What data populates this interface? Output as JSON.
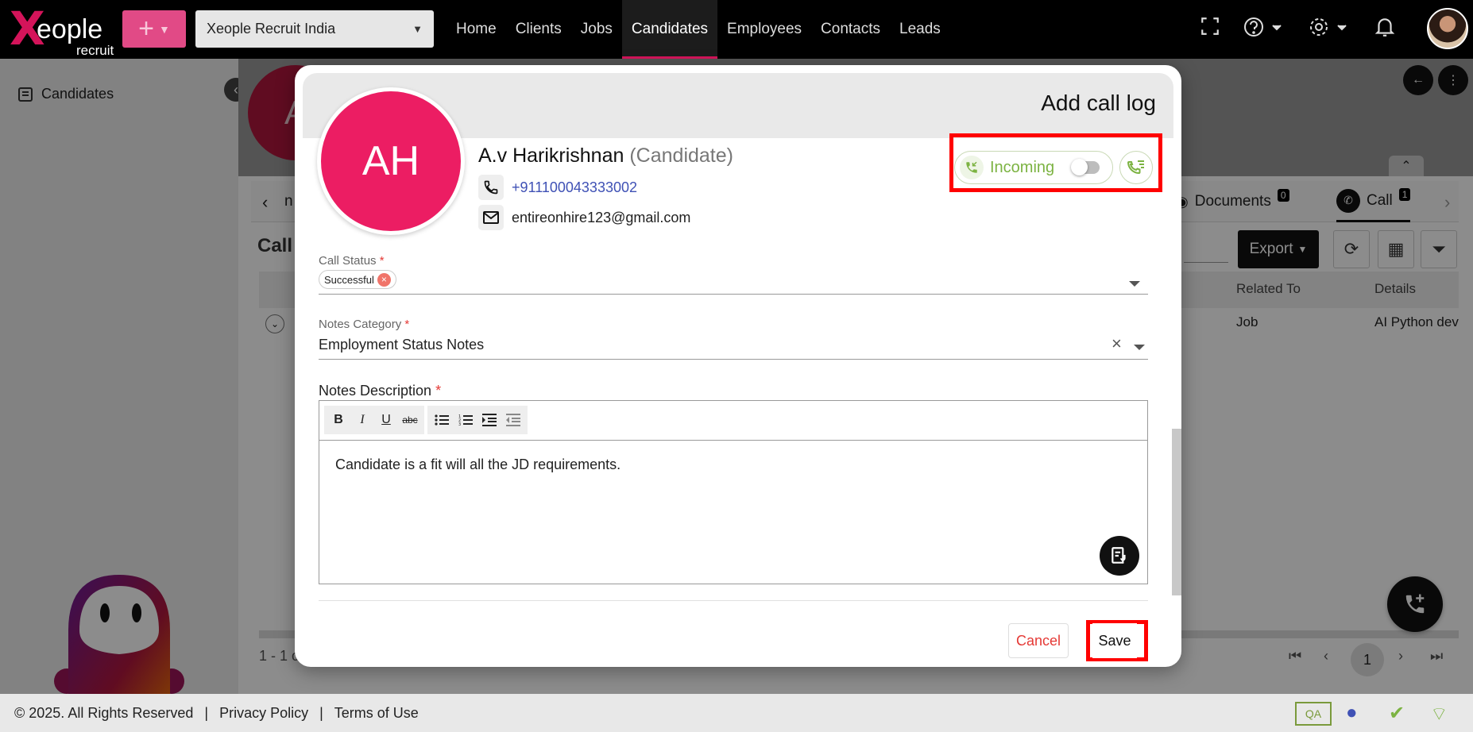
{
  "brand": {
    "logo_x": "X",
    "logo_word": "eople",
    "logo_sub": "recruit",
    "accent": "#d4145a"
  },
  "topbar": {
    "plus_label": "+",
    "org_select": "Xeople Recruit India",
    "nav": [
      "Home",
      "Clients",
      "Jobs",
      "Candidates",
      "Employees",
      "Contacts",
      "Leads"
    ],
    "active_nav": "Candidates"
  },
  "sidebar": {
    "item_label": "Candidates"
  },
  "background": {
    "avatar_letter": "A",
    "tab_partial": "n",
    "tabs": [
      {
        "label": "Documents",
        "count": "0"
      },
      {
        "label": "Call",
        "count": "1"
      }
    ],
    "section_title": "Call",
    "export_label": "Export",
    "columns": [
      "Related To",
      "Details"
    ],
    "row": {
      "related_to": "Job",
      "details": "AI Python dev"
    },
    "pager_summary": "1 - 1 o",
    "pager_page": "1"
  },
  "footer": {
    "copyright": "© 2025. All Rights Reserved",
    "sep": "|",
    "privacy": "Privacy Policy",
    "terms": "Terms of Use",
    "env_badge": "QA"
  },
  "modal": {
    "title": "Add call log",
    "avatar_initials": "AH",
    "candidate_name": "A.v Harikrishnan",
    "candidate_role": "(Candidate)",
    "phone": "+911100043333002",
    "email": "entireonhire123@gmail.com",
    "direction_label": "Incoming",
    "direction_color": "#7cb342",
    "call_status": {
      "label": "Call Status",
      "required": "*",
      "value": "Successful"
    },
    "notes_category": {
      "label": "Notes Category",
      "required": "*",
      "value": "Employment Status Notes",
      "clear": "×"
    },
    "notes_description": {
      "label": "Notes Description",
      "required": "*",
      "toolbar": [
        "B",
        "I",
        "U",
        "abc"
      ],
      "text": "Candidate is a fit will all the JD requirements."
    },
    "cancel_label": "Cancel",
    "save_label": "Save",
    "highlight_color": "#ff0000"
  }
}
